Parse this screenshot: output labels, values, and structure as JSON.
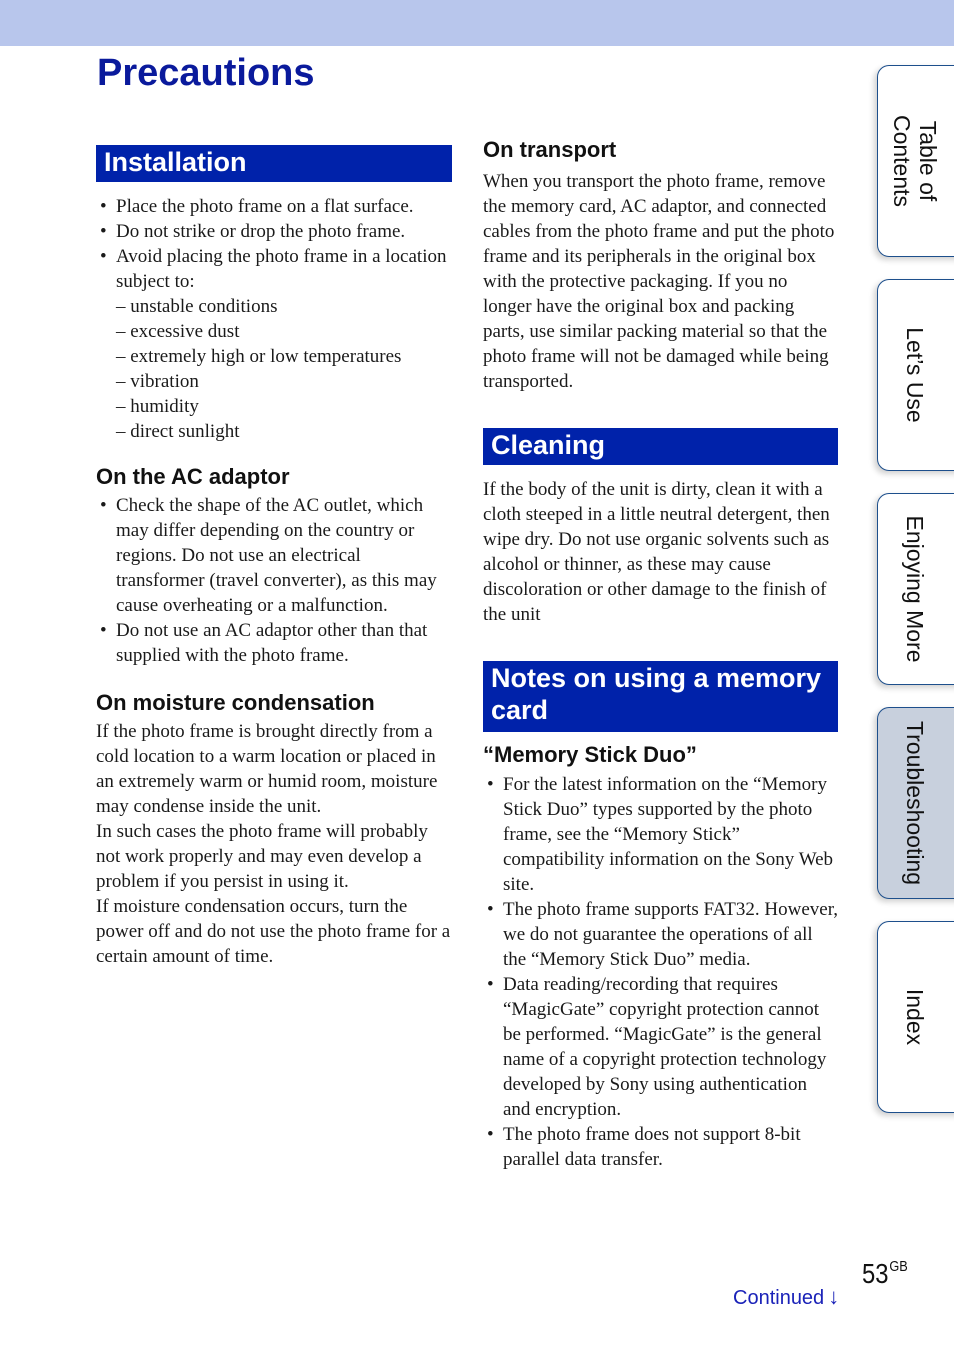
{
  "page": {
    "title": "Precautions",
    "page_number": "53",
    "page_suffix": "GB",
    "continued_label": "Continued",
    "continued_icon": "arrow-down-icon",
    "colors": {
      "header_band": "#b8c6ec",
      "title": "#0a1a9c",
      "section_band": "#0022aa",
      "tab_border": "#1d4f8c",
      "active_tab": "#c8d0dd",
      "continued": "#1a22b8"
    }
  },
  "side_tabs": [
    {
      "label": "Table of Contents",
      "line1": "Table of",
      "line2": "Contents",
      "active": false
    },
    {
      "label": "Let’s Use",
      "active": false
    },
    {
      "label": "Enjoying More",
      "active": false
    },
    {
      "label": "Troubleshooting",
      "active": true
    },
    {
      "label": "Index",
      "active": false
    }
  ],
  "left_column": {
    "installation": {
      "heading": "Installation",
      "bullets": [
        "Place the photo frame on a flat surface.",
        "Do not strike or drop the photo frame.",
        "Avoid placing the photo frame in a location subject to:"
      ],
      "conditions": [
        "– unstable conditions",
        "– excessive dust",
        "– extremely high or low temperatures",
        "– vibration",
        "– humidity",
        "– direct sunlight"
      ]
    },
    "ac_adaptor": {
      "heading": "On the AC adaptor",
      "bullets": [
        "Check the shape of the AC outlet, which may differ depending on the country or regions. Do not use an electrical transformer (travel converter), as this may cause overheating or a malfunction.",
        "Do not use an AC adaptor other than that supplied with the photo frame."
      ]
    },
    "moisture": {
      "heading": "On moisture condensation",
      "paragraphs": [
        "If the photo frame is brought directly from a cold location to a warm location or placed in an extremely warm or humid room, moisture may condense inside the unit.",
        "In such cases the photo frame will probably not work properly and may even develop a problem if you persist in using it.",
        "If moisture condensation occurs, turn the power off and do not use the photo frame for a certain amount of time."
      ]
    }
  },
  "right_column": {
    "transport": {
      "heading": "On transport",
      "text": "When you transport the photo frame, remove the memory card, AC adaptor, and connected cables from the photo frame and put the photo frame and its peripherals in the original box with the protective packaging. If you no longer have the original box and packing parts, use similar packing material so that the photo frame will not be damaged while being transported."
    },
    "cleaning": {
      "heading": "Cleaning",
      "text": "If the body of the unit is dirty, clean it with a cloth steeped in a little neutral detergent, then wipe dry. Do not use organic solvents such as alcohol or thinner, as these may cause discoloration or other damage to the finish of the unit"
    },
    "memory_card": {
      "heading": "Notes on using a memory card",
      "subheading": "“Memory Stick Duo”",
      "bullets": [
        "For the latest information on the “Memory Stick Duo” types supported by the photo frame, see the “Memory Stick” compatibility information on the Sony Web site.",
        "The photo frame supports FAT32. However, we do not guarantee the operations of all the “Memory Stick Duo” media.",
        "Data reading/recording that requires “MagicGate” copyright protection cannot be performed. “MagicGate” is the general name of a copyright protection technology developed by Sony using authentication and encryption.",
        "The photo frame does not support 8-bit parallel data transfer."
      ]
    }
  }
}
